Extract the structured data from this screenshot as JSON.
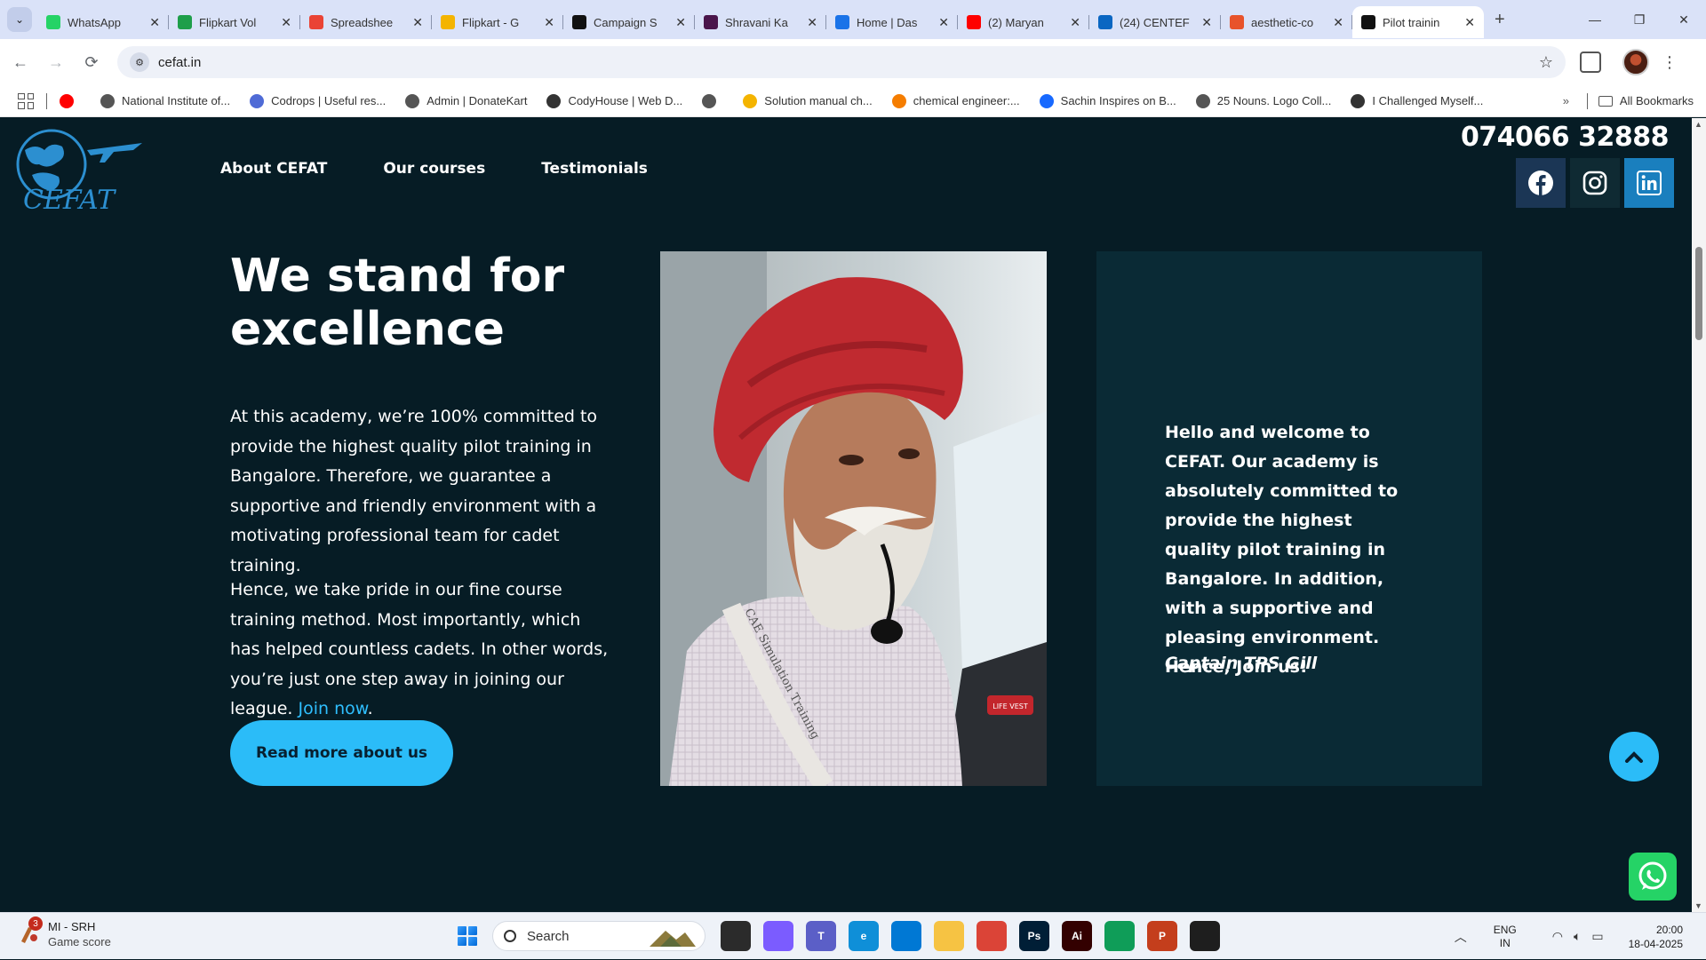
{
  "browser": {
    "tabs": [
      {
        "title": "WhatsApp",
        "icon": "whatsapp-icon",
        "color": "#25d366"
      },
      {
        "title": "Flipkart Vol",
        "icon": "sheets-icon",
        "color": "#1e9e4a"
      },
      {
        "title": "Spreadshee",
        "icon": "gmail-icon",
        "color": "#ea4335"
      },
      {
        "title": "Flipkart - G",
        "icon": "slides-icon",
        "color": "#f4b400"
      },
      {
        "title": "Campaign S",
        "icon": "trello-icon",
        "color": "#111111"
      },
      {
        "title": "Shravani Ka",
        "icon": "slack-icon",
        "color": "#4a154b"
      },
      {
        "title": "Home | Das",
        "icon": "k-icon",
        "color": "#1a73e8"
      },
      {
        "title": "(2) Maryan",
        "icon": "youtube-icon",
        "color": "#ff0000"
      },
      {
        "title": "(24) CENTEF",
        "icon": "linkedin-icon",
        "color": "#0a66c2"
      },
      {
        "title": "aesthetic-co",
        "icon": "figma-heart-icon",
        "color": "#e8532b"
      },
      {
        "title": "Pilot trainin",
        "icon": "x-icon",
        "color": "#111111",
        "active": true
      }
    ],
    "url": "cefat.in",
    "bookmarks": [
      {
        "label": "",
        "icon": "youtube-icon",
        "color": "#ff0000"
      },
      {
        "label": "National Institute of...",
        "icon": "globe-icon",
        "color": "#555555"
      },
      {
        "label": "Codrops | Useful res...",
        "icon": "codrops-icon",
        "color": "#4f6bd6"
      },
      {
        "label": "Admin | DonateKart",
        "icon": "globe-icon",
        "color": "#555555"
      },
      {
        "label": "CodyHouse | Web D...",
        "icon": "cody-icon",
        "color": "#333333"
      },
      {
        "label": "",
        "icon": "globe-icon",
        "color": "#555555"
      },
      {
        "label": "Solution manual ch...",
        "icon": "drive-icon",
        "color": "#f4b400"
      },
      {
        "label": "chemical engineer:...",
        "icon": "blogger-icon",
        "color": "#f57d00"
      },
      {
        "label": "Sachin Inspires on B...",
        "icon": "behance-icon",
        "color": "#1769ff"
      },
      {
        "label": "25 Nouns. Logo Coll...",
        "icon": "globe-icon",
        "color": "#555555"
      },
      {
        "label": "I Challenged Myself...",
        "icon": "alien-icon",
        "color": "#333333"
      }
    ],
    "all_bookmarks": "All Bookmarks"
  },
  "site": {
    "logo_text": "CEFAT",
    "nav": [
      "About CEFAT",
      "Our courses",
      "Testimonials"
    ],
    "phone": "074066 32888",
    "headline": "We stand for excellence",
    "para1": "At this academy, we’re 100% committed to provide the highest quality pilot training in Bangalore. Therefore, we guarantee a supportive and friendly environment with a motivating professional team for cadet training.",
    "para2": "Hence, we take pride in our fine course training method. Most importantly, which has helped countless cadets. In other words, you’re just one step away in joining our league.",
    "join_link": "Join now",
    "read_more": "Read more about us",
    "welcome": "Hello and welcome to CEFAT. Our academy is absolutely committed to provide the highest quality pilot training in Bangalore. In addition, with a supportive and pleasing environment. Hence, Join us!",
    "captain": "Captain TPS Gill",
    "lanyard_text": "CAE Simulation Training",
    "vest_label": "LIFE VEST",
    "colors": {
      "background": "#061c25",
      "card": "#0a2a35",
      "accent": "#2bbcf8",
      "link": "#2fbfff"
    }
  },
  "taskbar": {
    "widget_badge": "3",
    "widget_title": "MI - SRH",
    "widget_sub": "Game score",
    "search_placeholder": "Search",
    "lang_top": "ENG",
    "lang_bottom": "IN",
    "time": "20:00",
    "date": "18-04-2025",
    "apps": [
      {
        "name": "task-view-icon",
        "label": "",
        "color": "#2b2b2b"
      },
      {
        "name": "copilot-icon",
        "label": "",
        "color": "#7b5cff"
      },
      {
        "name": "teams-icon",
        "label": "T",
        "color": "#5b5fc7"
      },
      {
        "name": "edge-icon",
        "label": "e",
        "color": "#0f8fd8"
      },
      {
        "name": "store-icon",
        "label": "",
        "color": "#0078d4"
      },
      {
        "name": "file-explorer-icon",
        "label": "",
        "color": "#f6c343"
      },
      {
        "name": "chrome-icon",
        "label": "",
        "color": "#db4437"
      },
      {
        "name": "photoshop-icon",
        "label": "Ps",
        "color": "#001e36"
      },
      {
        "name": "illustrator-icon",
        "label": "Ai",
        "color": "#330000"
      },
      {
        "name": "chrome-profile-icon",
        "label": "",
        "color": "#0f9d58"
      },
      {
        "name": "powerpoint-icon",
        "label": "P",
        "color": "#c43e1c"
      },
      {
        "name": "figma-icon",
        "label": "",
        "color": "#1e1e1e"
      }
    ]
  }
}
